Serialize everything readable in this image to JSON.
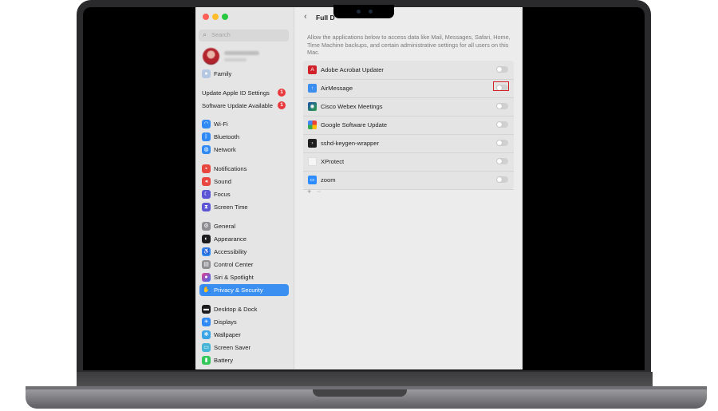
{
  "search": {
    "placeholder": "Search"
  },
  "sidebar": {
    "family": "Family",
    "update_apple_id": "Update Apple ID Settings",
    "update_apple_id_badge": "1",
    "software_update": "Software Update Available",
    "software_update_badge": "1",
    "items": [
      {
        "label": "Wi-Fi",
        "icon": "wifi-icon",
        "color": "#2f8af5"
      },
      {
        "label": "Bluetooth",
        "icon": "bluetooth-icon",
        "color": "#2f8af5"
      },
      {
        "label": "Network",
        "icon": "globe-icon",
        "color": "#2f8af5"
      },
      {
        "label": "Notifications",
        "icon": "bell-icon",
        "color": "#e8473f"
      },
      {
        "label": "Sound",
        "icon": "speaker-icon",
        "color": "#e8473f"
      },
      {
        "label": "Focus",
        "icon": "moon-icon",
        "color": "#5b55d6"
      },
      {
        "label": "Screen Time",
        "icon": "hourglass-icon",
        "color": "#5b55d6"
      },
      {
        "label": "General",
        "icon": "gear-icon",
        "color": "#8e8e93"
      },
      {
        "label": "Appearance",
        "icon": "appearance-icon",
        "color": "#1c1c1e"
      },
      {
        "label": "Accessibility",
        "icon": "accessibility-icon",
        "color": "#2f8af5"
      },
      {
        "label": "Control Center",
        "icon": "control-center-icon",
        "color": "#8e8e93"
      },
      {
        "label": "Siri & Spotlight",
        "icon": "siri-icon",
        "color": "#7a4fd6"
      },
      {
        "label": "Privacy & Security",
        "icon": "hand-icon",
        "color": "#2f8af5"
      },
      {
        "label": "Desktop & Dock",
        "icon": "dock-icon",
        "color": "#1c1c1e"
      },
      {
        "label": "Displays",
        "icon": "sun-icon",
        "color": "#2f8af5"
      },
      {
        "label": "Wallpaper",
        "icon": "wallpaper-icon",
        "color": "#3aa5e6"
      },
      {
        "label": "Screen Saver",
        "icon": "screensaver-icon",
        "color": "#46b4d6"
      },
      {
        "label": "Battery",
        "icon": "battery-icon",
        "color": "#34c759"
      }
    ]
  },
  "header": {
    "title": "Full D"
  },
  "description": "Allow the applications below to access data like Mail, Messages, Safari, Home, Time Machine backups, and certain administrative settings for all users on this Mac.",
  "apps": [
    {
      "name": "Adobe Acrobat Updater",
      "icon": "acrobat-icon",
      "enabled": false
    },
    {
      "name": "AirMessage",
      "icon": "airmessage-icon",
      "enabled": false
    },
    {
      "name": "Cisco Webex Meetings",
      "icon": "webex-icon",
      "enabled": false
    },
    {
      "name": "Google Software Update",
      "icon": "google-update-icon",
      "enabled": false
    },
    {
      "name": "sshd-keygen-wrapper",
      "icon": "terminal-icon",
      "enabled": false
    },
    {
      "name": "XProtect",
      "icon": "xprotect-icon",
      "enabled": false
    },
    {
      "name": "zoom",
      "icon": "zoom-icon",
      "enabled": false
    }
  ],
  "list_footer": {
    "add": "+",
    "remove": "−"
  }
}
